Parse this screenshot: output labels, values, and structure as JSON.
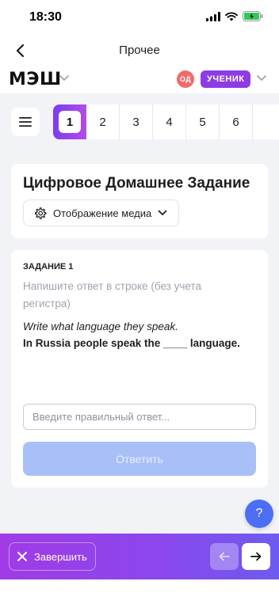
{
  "status": {
    "time": "18:30"
  },
  "nav": {
    "title": "Прочее"
  },
  "header": {
    "logo": "МЭШ",
    "avatar_initials": "ОД",
    "role": "УЧЕНИК"
  },
  "tabs": [
    "1",
    "2",
    "3",
    "4",
    "5",
    "6"
  ],
  "active_tab": "1",
  "homework": {
    "title": "Цифровое Домашнее Задание",
    "media_button": "Отображение медиа"
  },
  "task": {
    "label": "ЗАДАНИЕ 1",
    "hint": "Напишите ответ в строке (без учета регистра)",
    "instruction": "Write what language they speak.",
    "sentence": "In Russia people speak the ____ language.",
    "input_value": "",
    "input_placeholder": "Введите правильный ответ...",
    "submit_label": "Ответить"
  },
  "help": {
    "label": "?"
  },
  "bottom": {
    "finish_label": "Завершить"
  },
  "colors": {
    "accent": "#8D3BE5",
    "primary": "#4C6EF5",
    "avatar": "#F26A6A",
    "submit_disabled": "#A9BFF7"
  },
  "icons": [
    "back-arrow-icon",
    "chevron-down-icon",
    "menu-icon",
    "gear-icon",
    "close-icon",
    "arrow-left-icon",
    "arrow-right-icon",
    "signal-icon",
    "wifi-icon",
    "battery-icon"
  ]
}
